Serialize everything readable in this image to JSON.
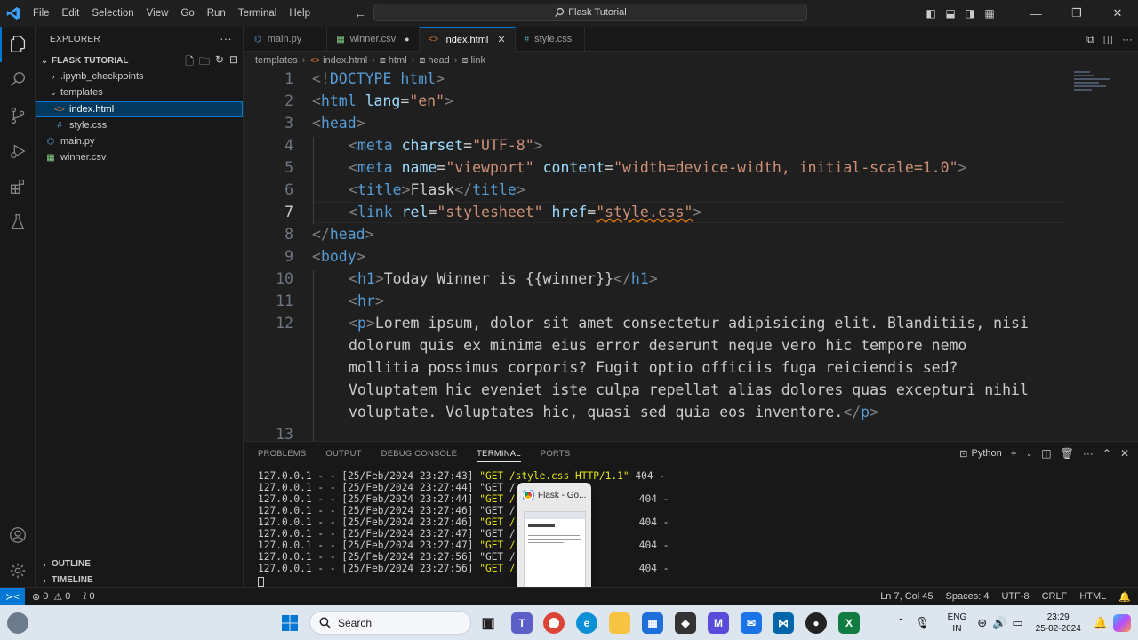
{
  "menu": [
    "File",
    "Edit",
    "Selection",
    "View",
    "Go",
    "Run",
    "Terminal",
    "Help"
  ],
  "search": {
    "label": "Flask Tutorial"
  },
  "explorer": {
    "title": "EXPLORER",
    "folder": "FLASK TUTORIAL",
    "items": [
      {
        "label": ".ipynb_checkpoints",
        "kind": "folder-collapsed"
      },
      {
        "label": "templates",
        "kind": "folder-open"
      },
      {
        "label": "index.html",
        "kind": "html",
        "selected": true
      },
      {
        "label": "style.css",
        "kind": "css"
      },
      {
        "label": "main.py",
        "kind": "py"
      },
      {
        "label": "winner.csv",
        "kind": "csv"
      }
    ],
    "outline": "OUTLINE",
    "timeline": "TIMELINE"
  },
  "tabs": [
    {
      "label": "main.py",
      "icon": "python-icon"
    },
    {
      "label": "winner.csv",
      "icon": "csv-icon",
      "modified": true
    },
    {
      "label": "index.html",
      "icon": "html-icon",
      "active": true
    },
    {
      "label": "style.css",
      "icon": "css-icon"
    }
  ],
  "breadcrumb": [
    "templates",
    "index.html",
    "html",
    "head",
    "link"
  ],
  "editor": {
    "line_numbers": [
      "1",
      "2",
      "3",
      "4",
      "5",
      "6",
      "7",
      "8",
      "9",
      "10",
      "11",
      "12",
      "13"
    ],
    "current_line": "7",
    "lines": [
      "<!DOCTYPE html>",
      "<html lang=\"en\">",
      "<head>",
      "<meta charset=\"UTF-8\">",
      "<meta name=\"viewport\" content=\"width=device-width, initial-scale=1.0\">",
      "<title>Flask</title>",
      "<link rel=\"stylesheet\" href=\"style.css\">",
      "</head>",
      "<body>",
      "<h1>Today Winner is {{winner}}</h1>",
      "<hr>",
      "<p>Lorem ipsum, dolor sit amet consectetur adipisicing elit. Blanditiis, nisi",
      "dolorum quis ex minima eius error deserunt neque vero hic tempore nemo",
      "mollitia possimus corporis? Fugit optio officiis fuga reiciendis sed?",
      "Voluptatem hic eveniet iste culpa repellat alias dolores quas excepturi nihil",
      "voluptate. Voluptates hic, quasi sed quia eos inventore.</p>"
    ]
  },
  "panel": {
    "tabs": [
      "PROBLEMS",
      "OUTPUT",
      "DEBUG CONSOLE",
      "TERMINAL",
      "PORTS"
    ],
    "active_tab": "TERMINAL",
    "shell": "Python",
    "log": [
      {
        "prefix": "127.0.0.1 - - [25/Feb/2024 23:27:43] ",
        "req": "\"GET /style.css HTTP/1.1\"",
        "status": " 404 -"
      },
      {
        "prefix": "127.0.0.1 - - [25/Feb/2024 23:27:44] ",
        "req": "\"GET / HTTP/",
        "status": ""
      },
      {
        "prefix": "127.0.0.1 - - [25/Feb/2024 23:27:44] ",
        "req": "\"GET /style.",
        "status": " 404 -"
      },
      {
        "prefix": "127.0.0.1 - - [25/Feb/2024 23:27:46] ",
        "req": "\"GET / HTTP/",
        "status": ""
      },
      {
        "prefix": "127.0.0.1 - - [25/Feb/2024 23:27:46] ",
        "req": "\"GET /style.",
        "status": " 404 -"
      },
      {
        "prefix": "127.0.0.1 - - [25/Feb/2024 23:27:47] ",
        "req": "\"GET / HTTP/",
        "status": ""
      },
      {
        "prefix": "127.0.0.1 - - [25/Feb/2024 23:27:47] ",
        "req": "\"GET /style.",
        "status": " 404 -"
      },
      {
        "prefix": "127.0.0.1 - - [25/Feb/2024 23:27:56] ",
        "req": "\"GET / HTTP/",
        "status": ""
      },
      {
        "prefix": "127.0.0.1 - - [25/Feb/2024 23:27:56] ",
        "req": "\"GET /style.",
        "status": " 404 -"
      }
    ]
  },
  "preview": {
    "title": "Flask - Go..."
  },
  "status": {
    "errors": "0",
    "warnings": "0",
    "ports": "0",
    "position": "Ln 7, Col 45",
    "spaces": "Spaces: 4",
    "encoding": "UTF-8",
    "eol": "CRLF",
    "language": "HTML"
  },
  "taskbar": {
    "search": "Search",
    "lang_top": "ENG",
    "lang_bottom": "IN",
    "time": "23:29",
    "date": "25-02-2024"
  },
  "colors": {
    "accent": "#0078d4",
    "tag": "#569cd6",
    "attr": "#9cdcfe",
    "string": "#ce9178"
  }
}
